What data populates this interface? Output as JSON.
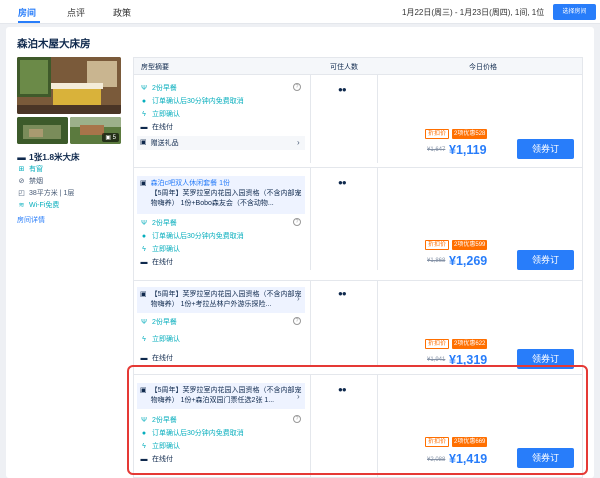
{
  "nav": {
    "tabs": [
      "房间",
      "点评",
      "政策"
    ],
    "date_info": "1月22日(周三) - 1月23日(周四), 1间, 1位",
    "select_room_label": "选择房间"
  },
  "room": {
    "title": "森泊木屋大床房",
    "photo_count": "5",
    "bed": "1张1.8米大床",
    "window": "有窗",
    "smoking": "禁烟",
    "area": "38平方米 | 1层",
    "wifi": "Wi-Fi免费",
    "detail_link": "房间详情"
  },
  "table": {
    "headers": [
      "房型摘要",
      "可住人数",
      "今日价格"
    ]
  },
  "offers": [
    {
      "package": "",
      "breakfast": "2份早餐",
      "cancel": "订单确认后30分钟内免费取消",
      "confirm": "立即确认",
      "payment": "在线付",
      "gift": "赠送礼品",
      "tag_discount": "折扣价",
      "tag_promo": "2项优惠528",
      "original_price": "¥1,647",
      "price": "¥1,119",
      "book_label": "领券订"
    },
    {
      "package": "森泊c吧双人休闲套餐 1份",
      "package2": "【5周年】芙罗拉室内花园入园资格（不含内部宠物嗨养） 1份+Bobo森友会（不含动物...",
      "breakfast": "2份早餐",
      "cancel": "订单确认后30分钟内免费取消",
      "confirm": "立即确认",
      "payment": "在线付",
      "tag_discount": "折扣价",
      "tag_promo": "2项优惠599",
      "original_price": "¥1,868",
      "price": "¥1,269",
      "book_label": "领券订"
    },
    {
      "package": "【5周年】芙罗拉室内花园入园资格（不含内部宠物嗨养） 1份+考拉丛林户外游乐探险...",
      "breakfast": "2份早餐",
      "confirm": "立即确认",
      "payment": "在线付",
      "tag_discount": "折扣价",
      "tag_promo": "2项优惠622",
      "original_price": "¥1,941",
      "price": "¥1,319",
      "book_label": "领券订"
    },
    {
      "package": "【5周年】芙罗拉室内花园入园资格（不含内部宠物嗨养） 1份+森泊双园门票任选2张 1...",
      "breakfast": "2份早餐",
      "cancel": "订单确认后30分钟内免费取消",
      "confirm": "立即确认",
      "payment": "在线付",
      "tag_discount": "折扣价",
      "tag_promo": "2项优惠669",
      "original_price": "¥2,088",
      "price": "¥1,419",
      "book_label": "领券订"
    }
  ],
  "colors": {
    "accent": "#287dfa",
    "promo": "#ff6f00",
    "green": "#06aebd",
    "highlight": "#e53935"
  }
}
